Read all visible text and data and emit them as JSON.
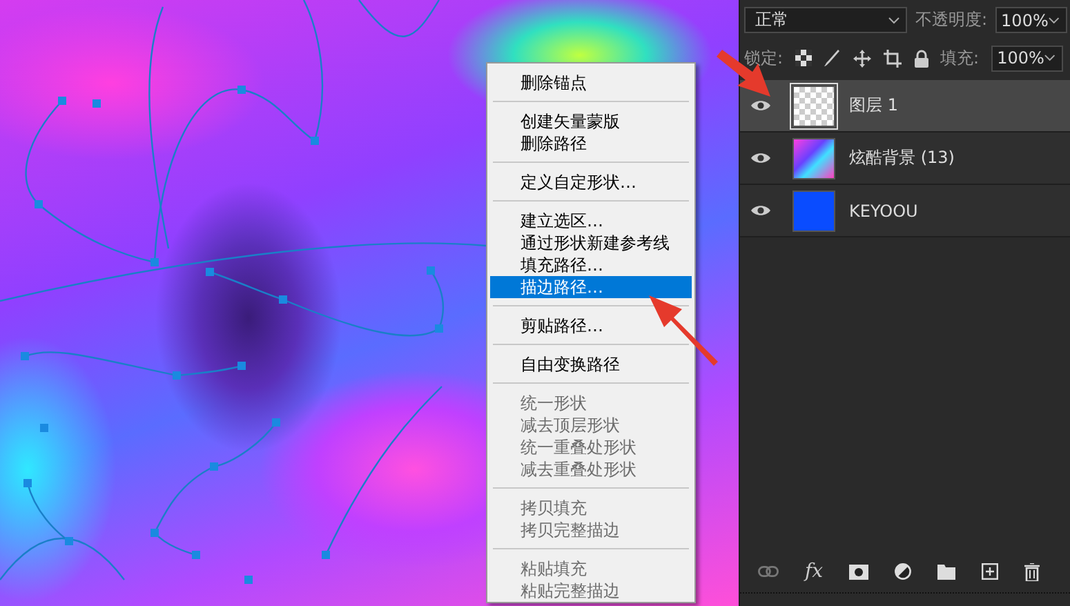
{
  "context_menu": {
    "groups": [
      [
        {
          "label": "删除锚点",
          "disabled": false,
          "selected": false
        }
      ],
      [
        {
          "label": "创建矢量蒙版",
          "disabled": false,
          "selected": false
        },
        {
          "label": "删除路径",
          "disabled": false,
          "selected": false
        }
      ],
      [
        {
          "label": "定义自定形状…",
          "disabled": false,
          "selected": false
        }
      ],
      [
        {
          "label": "建立选区…",
          "disabled": false,
          "selected": false
        },
        {
          "label": "通过形状新建参考线",
          "disabled": false,
          "selected": false
        },
        {
          "label": "填充路径…",
          "disabled": false,
          "selected": false
        },
        {
          "label": "描边路径…",
          "disabled": false,
          "selected": true
        }
      ],
      [
        {
          "label": "剪贴路径…",
          "disabled": false,
          "selected": false
        }
      ],
      [
        {
          "label": "自由变换路径",
          "disabled": false,
          "selected": false
        }
      ],
      [
        {
          "label": "统一形状",
          "disabled": true,
          "selected": false
        },
        {
          "label": "减去顶层形状",
          "disabled": true,
          "selected": false
        },
        {
          "label": "统一重叠处形状",
          "disabled": true,
          "selected": false
        },
        {
          "label": "减去重叠处形状",
          "disabled": true,
          "selected": false
        }
      ],
      [
        {
          "label": "拷贝填充",
          "disabled": true,
          "selected": false
        },
        {
          "label": "拷贝完整描边",
          "disabled": true,
          "selected": false
        }
      ],
      [
        {
          "label": "粘贴填充",
          "disabled": true,
          "selected": false
        },
        {
          "label": "粘贴完整描边",
          "disabled": true,
          "selected": false
        }
      ]
    ]
  },
  "layers_panel": {
    "blend_mode": "正常",
    "opacity_label": "不透明度:",
    "opacity": "100%",
    "lock_label": "锁定:",
    "fill_label": "填充:",
    "fill": "100%",
    "effects_button": "fx",
    "layers": [
      {
        "name": "图层 1",
        "kind": "transparent",
        "selected": true
      },
      {
        "name": "炫酷背景 (13)",
        "kind": "image",
        "selected": false
      },
      {
        "name": "KEYOOU",
        "kind": "fill",
        "selected": false
      }
    ]
  }
}
